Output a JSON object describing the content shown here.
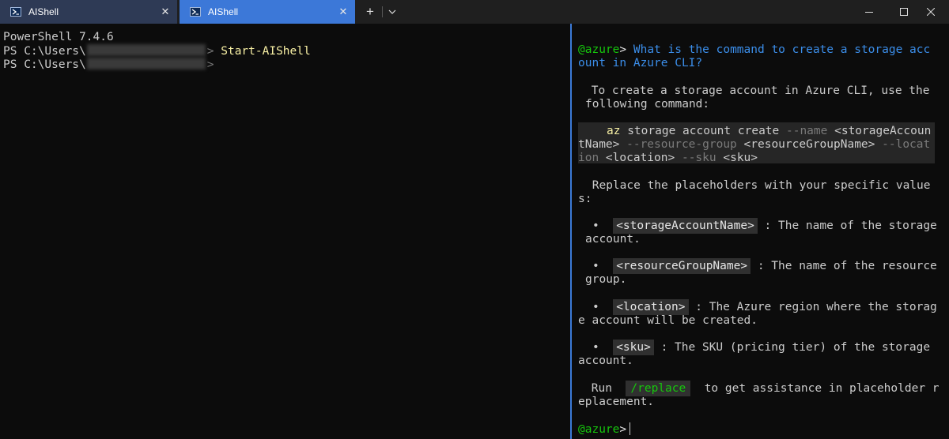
{
  "tabs": [
    {
      "title": "AIShell",
      "close": "✕"
    },
    {
      "title": "AIShell",
      "close": "✕"
    }
  ],
  "titlebar": {
    "new_tab": "+"
  },
  "left": {
    "lines": [
      "PowerShell 7.4.6",
      "PS C:\\Users\\",
      "PS C:\\Users\\"
    ],
    "redaction_close": ">",
    "command": " Start-AIShell"
  },
  "right": {
    "prompt_user": "@azure",
    "prompt_gt": ">",
    "question_line1": "What is the command to create a storage acc",
    "question_line2": "ount in Azure CLI?",
    "intro1": " To create a storage account in Azure CLI, use the",
    "intro2": "following command:",
    "code_az": "az",
    "code1_a": " storage account create ",
    "code1_b": "--name",
    "code1_c": " <storageAccoun",
    "code2_a": "tName> ",
    "code2_b": "--resource-group",
    "code2_c": " <resourceGroupName> ",
    "code2_d": "--locat",
    "code3_a": "ion",
    "code3_b": " <location> ",
    "code3_c": "--sku",
    "code3_d": " <sku>",
    "replace1": " Replace the placeholders with your specific value",
    "replace2": "s:",
    "bullet": "•",
    "b1_chip": "<storageAccountName>",
    "b1_text": ": The name of the storage",
    "b1_cont": "account.",
    "b2_chip": "<resourceGroupName>",
    "b2_text": ": The name of the resource",
    "b2_cont": "group.",
    "b3_chip": "<location>",
    "b3_text": ": The Azure region where the storag",
    "b3_cont": "e account will be created.",
    "b4_chip": "<sku>",
    "b4_text": ": The SKU (pricing tier) of the storage",
    "b4_cont": "account.",
    "run_label": " Run",
    "run_chip": "/replace",
    "run_text": " to get assistance in placeholder r",
    "run_cont": "eplacement."
  },
  "colors": {
    "accent": "#3c78d8",
    "prompt_green": "#16c60c",
    "question_blue": "#3b8eea",
    "command_yellow": "#f9f1a5"
  }
}
